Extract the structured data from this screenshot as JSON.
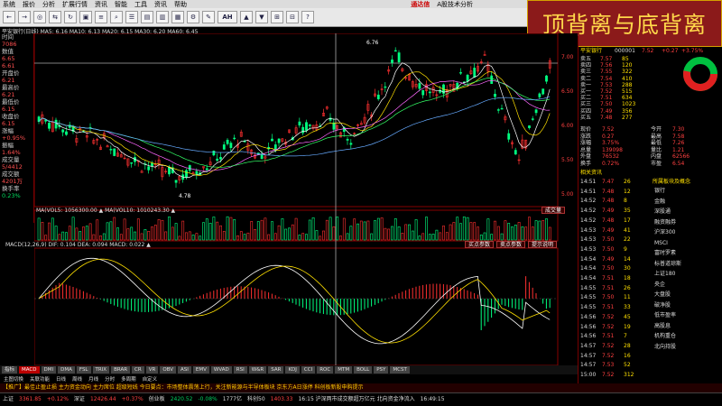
{
  "menu": {
    "items": [
      "系统",
      "报价",
      "分析",
      "扩展行情",
      "资讯",
      "智能",
      "工具",
      "资讯",
      "帮助"
    ],
    "brand": "通达信",
    "app_title": "A股技术分析"
  },
  "banner": {
    "text": "顶背离与底背离"
  },
  "toolbar": {
    "buttons": [
      "←",
      "→",
      "◎",
      "⇆",
      "↻",
      "▣",
      "≡",
      "⌕",
      "☰",
      "▤",
      "▥",
      "▦",
      "⚙",
      "✎",
      "AH",
      "▲",
      "▼",
      "⊞",
      "⊟",
      "?"
    ],
    "wide_index": 14
  },
  "info_line": "平安银行(日线)  MA5: 6.16  MA10: 6.13  MA20: 6.15  MA30: 6.20  MA60: 6.45",
  "left_panel": [
    {
      "t": "时间",
      "c": ""
    },
    {
      "t": "7086",
      "c": "v"
    },
    {
      "t": "数值",
      "c": ""
    },
    {
      "t": "6.65",
      "c": "v"
    },
    {
      "t": "6.61",
      "c": "v"
    },
    {
      "t": "开盘价",
      "c": ""
    },
    {
      "t": "6.21",
      "c": "v"
    },
    {
      "t": "最高价",
      "c": ""
    },
    {
      "t": "6.21",
      "c": "v"
    },
    {
      "t": "最低价",
      "c": ""
    },
    {
      "t": "6.15",
      "c": "v"
    },
    {
      "t": "收盘价",
      "c": ""
    },
    {
      "t": "6.15",
      "c": "v"
    },
    {
      "t": "涨幅",
      "c": ""
    },
    {
      "t": "+0.95%",
      "c": "v"
    },
    {
      "t": "振幅",
      "c": ""
    },
    {
      "t": "1.64%",
      "c": "v"
    },
    {
      "t": "成交量",
      "c": ""
    },
    {
      "t": "5/4412",
      "c": "v"
    },
    {
      "t": "成交额",
      "c": ""
    },
    {
      "t": "4201万",
      "c": "v"
    },
    {
      "t": "换手率",
      "c": ""
    },
    {
      "t": "0.23%",
      "c": "g"
    }
  ],
  "price_labels": {
    "high": "6.76",
    "low": "4.78"
  },
  "axis_right": [
    "7.00",
    "6.50",
    "6.00",
    "5.50",
    "5.00"
  ],
  "vol_info": "MA(VOL5: 1056300.00 ▲  MA(VOL10: 1010243.30 ▲",
  "vol_chip": "成交量",
  "macd_info": "MACD(12,26,9)  DIF: 0.104  DEA: 0.094  MACD: 0.022 ▲",
  "macd_chips": [
    "买点参数",
    "卖点参数",
    "提示说明"
  ],
  "bottom_tabs": [
    "指标",
    "MACD",
    "DMI",
    "DMA",
    "FSL",
    "TRIX",
    "BRAR",
    "CR",
    "VR",
    "OBV",
    "ASI",
    "EMV",
    "WVAD",
    "RSI",
    "W&R",
    "SAR",
    "KDJ",
    "CCI",
    "ROC",
    "MTM",
    "BOLL",
    "PSY",
    "MCST"
  ],
  "bottom_tabs2": [
    "主图切换",
    "关联功能",
    "日线",
    "周线",
    "月线",
    "分时",
    "多周期",
    "自定义"
  ],
  "ticker": "【推广】最佳止盈止损  主力资金动向  主力席位  超级短线  今日要点：市场整体震荡上行，关注新能源与半导体板块  京东方A日涨停  科创板新股申购提示",
  "status": {
    "items": [
      {
        "t": "上证",
        "c": ""
      },
      {
        "t": "3361.85",
        "c": "r"
      },
      {
        "t": "+0.12%",
        "c": "r"
      },
      {
        "t": "深证",
        "c": ""
      },
      {
        "t": "12426.44",
        "c": "r"
      },
      {
        "t": "+0.37%",
        "c": "r"
      },
      {
        "t": "创业板",
        "c": ""
      },
      {
        "t": "2420.52",
        "c": "g"
      },
      {
        "t": "-0.08%",
        "c": "g"
      },
      {
        "t": "1777亿",
        "c": ""
      },
      {
        "t": "科创50",
        "c": ""
      },
      {
        "t": "1403.33",
        "c": "r"
      },
      {
        "t": "16:15 沪深两市成交额超万亿元  北向资金净流入",
        "c": ""
      },
      {
        "t": "16:49:15",
        "c": ""
      }
    ]
  },
  "right_panel": {
    "title": "平安银行",
    "code": "000001",
    "price": "7.52",
    "change": "+0.27",
    "pct": "+3.75%",
    "rows_left": [
      {
        "l": "卖五",
        "v": "7.57",
        "q": "85"
      },
      {
        "l": "卖四",
        "v": "7.56",
        "q": "120"
      },
      {
        "l": "卖三",
        "v": "7.55",
        "q": "322"
      },
      {
        "l": "卖二",
        "v": "7.54",
        "q": "410"
      },
      {
        "l": "卖一",
        "v": "7.53",
        "q": "288"
      },
      {
        "l": "买一",
        "v": "7.52",
        "q": "515"
      },
      {
        "l": "买二",
        "v": "7.51",
        "q": "634"
      },
      {
        "l": "买三",
        "v": "7.50",
        "q": "1023"
      },
      {
        "l": "买四",
        "v": "7.49",
        "q": "356"
      },
      {
        "l": "买五",
        "v": "7.48",
        "q": "277"
      }
    ],
    "stats": [
      {
        "l": "现价",
        "v": "7.52"
      },
      {
        "l": "今开",
        "v": "7.30"
      },
      {
        "l": "涨跌",
        "v": "0.27"
      },
      {
        "l": "最高",
        "v": "7.58"
      },
      {
        "l": "涨幅",
        "v": "3.75%"
      },
      {
        "l": "最低",
        "v": "7.26"
      },
      {
        "l": "总量",
        "v": "139098"
      },
      {
        "l": "量比",
        "v": "1.21"
      },
      {
        "l": "外盘",
        "v": "76532"
      },
      {
        "l": "内盘",
        "v": "62566"
      },
      {
        "l": "换手",
        "v": "0.72%"
      },
      {
        "l": "市盈",
        "v": "6.54"
      }
    ],
    "ticks": [
      {
        "t": "14:51",
        "p": "7.47",
        "q": "26"
      },
      {
        "t": "14:51",
        "p": "7.48",
        "q": "12"
      },
      {
        "t": "14:52",
        "p": "7.48",
        "q": "8"
      },
      {
        "t": "14:52",
        "p": "7.49",
        "q": "35"
      },
      {
        "t": "14:52",
        "p": "7.48",
        "q": "17"
      },
      {
        "t": "14:53",
        "p": "7.49",
        "q": "41"
      },
      {
        "t": "14:53",
        "p": "7.50",
        "q": "22"
      },
      {
        "t": "14:53",
        "p": "7.50",
        "q": "9"
      },
      {
        "t": "14:54",
        "p": "7.49",
        "q": "14"
      },
      {
        "t": "14:54",
        "p": "7.50",
        "q": "30"
      },
      {
        "t": "14:54",
        "p": "7.51",
        "q": "18"
      },
      {
        "t": "14:55",
        "p": "7.51",
        "q": "26"
      },
      {
        "t": "14:55",
        "p": "7.50",
        "q": "11"
      },
      {
        "t": "14:55",
        "p": "7.51",
        "q": "33"
      },
      {
        "t": "14:56",
        "p": "7.52",
        "q": "45"
      },
      {
        "t": "14:56",
        "p": "7.52",
        "q": "19"
      },
      {
        "t": "14:56",
        "p": "7.51",
        "q": "7"
      },
      {
        "t": "14:57",
        "p": "7.52",
        "q": "28"
      },
      {
        "t": "14:57",
        "p": "7.52",
        "q": "16"
      },
      {
        "t": "14:57",
        "p": "7.53",
        "q": "52"
      },
      {
        "t": "15:00",
        "p": "7.52",
        "q": "312"
      }
    ],
    "sectors": [
      "银行",
      "金融",
      "深股通",
      "融资融券",
      "沪深300",
      "MSCI",
      "富时罗素",
      "标普道琼斯",
      "上证180",
      "央企",
      "大盘股",
      "破净股",
      "低市盈率",
      "高股息",
      "机构重仓",
      "北向持股"
    ],
    "sector_header": "所属板块及概念",
    "news_header": "相关资讯"
  },
  "colors": {
    "up": "#ff3030",
    "down": "#00ff80",
    "ma_white": "#ffffff",
    "ma_yellow": "#ffe000",
    "ma_pink": "#ff66ff",
    "ma_green": "#33ff66",
    "ma_blue": "#66aaff",
    "frame": "#880000"
  }
}
